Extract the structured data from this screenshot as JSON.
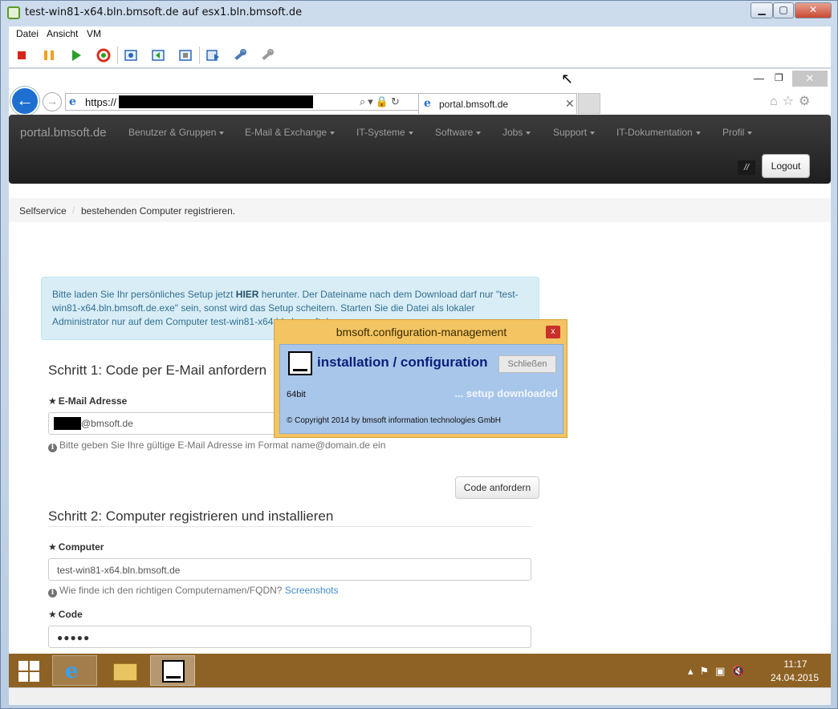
{
  "vm": {
    "title": "test-win81-x64.bln.bmsoft.de auf esx1.bln.bmsoft.de",
    "controls": {
      "minimize": "▁",
      "maximize": "▢",
      "close": "✕"
    },
    "menu": [
      "Datei",
      "Ansicht",
      "VM"
    ]
  },
  "browser": {
    "address_prefix": "https://",
    "tab_title": "portal.bmsoft.de",
    "tab_close": "✕",
    "window_minimize": "—",
    "window_restore": "❐",
    "window_close": "✕",
    "toolbar_icons": "⌂☆⚙",
    "address_tools": "⌕▾🔒↻"
  },
  "navbar": {
    "brand": "portal.bmsoft.de",
    "items": [
      "Benutzer & Gruppen",
      "E-Mail & Exchange",
      "IT-Systeme",
      "Software",
      "Jobs",
      "Support",
      "IT-Dokumentation",
      "Profil"
    ],
    "slash": "//",
    "logout": "Logout"
  },
  "breadcrumb": {
    "first": "Selfservice",
    "separator": "/",
    "current": "bestehenden Computer registrieren."
  },
  "alert": {
    "before": "Bitte laden Sie Ihr persönliches Setup jetzt ",
    "link": "HIER",
    "after": " herunter. Der Dateiname nach dem Download darf nur \"test-win81-x64.bln.bmsoft.de.exe\" sein, sonst wird das Setup scheitern. Starten Sie die Datei als lokaler Administrator nur auf dem Computer test-win81-x64.bln.bmsoft.de."
  },
  "step1": {
    "heading": "Schritt 1: Code per E-Mail anfordern",
    "email_label": "E-Mail Adresse",
    "email_value": "@bmsoft.de",
    "email_help": "Bitte geben Sie Ihre gültige E-Mail Adresse im Format name@domain.de ein",
    "button": "Code anfordern"
  },
  "step2": {
    "heading": "Schritt 2: Computer registrieren und installieren",
    "computer_label": "Computer",
    "computer_value": "test-win81-x64.bln.bmsoft.de",
    "computer_help": "Wie finde ich den richtigen Computernamen/FQDN?",
    "computer_help_link": "Screenshots",
    "code_label": "Code",
    "code_value": "●●●●●"
  },
  "popup": {
    "title": "bmsoft.configuration-management",
    "close": "x",
    "heading": "installation / configuration",
    "button": "Schließen",
    "arch": "64bit",
    "status": "... setup downloaded",
    "copyright": "© Copyright 2014 by bmsoft information technologies GmbH"
  },
  "taskbar": {
    "time": "11:17",
    "date": "24.04.2015",
    "tray": "▴⚑▣🔇"
  }
}
